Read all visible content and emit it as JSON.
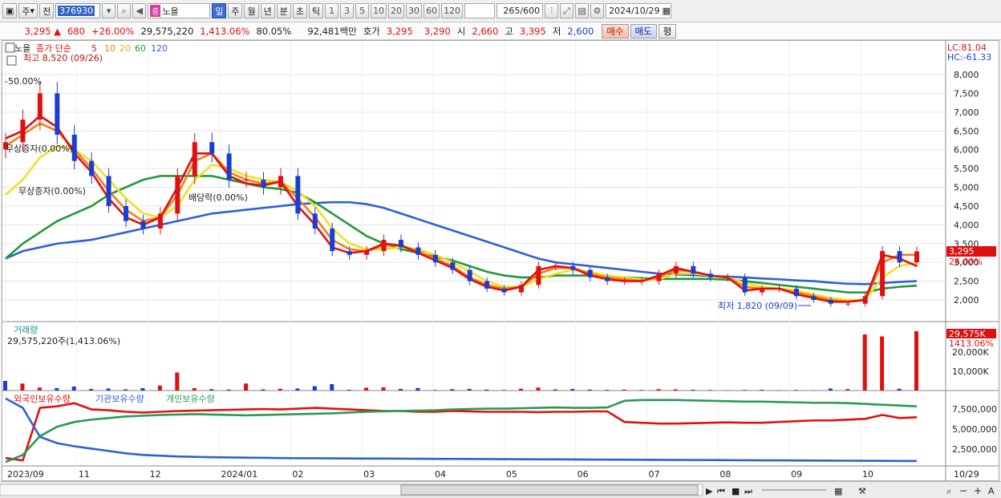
{
  "toolbar": {
    "type_label": "주",
    "prev_label": "전",
    "code": "376930",
    "name_tag": "중",
    "name": "노을",
    "periods": [
      "일",
      "주",
      "월",
      "년",
      "분",
      "초",
      "틱"
    ],
    "active_period": "일",
    "intervals": [
      "1",
      "3",
      "5",
      "10",
      "20",
      "30",
      "60",
      "120"
    ],
    "count": "265",
    "count_max": "/600",
    "date": "2024/10/29"
  },
  "quote": {
    "price": "3,295",
    "change": "680",
    "change_pct": "+26.00%",
    "volume": "29,575,220",
    "volume_ratio": "1,413.06%",
    "turnover": "80.05%",
    "amount": "92,481백만",
    "bid_label": "호가",
    "ask": "3,295",
    "bid": "3,290",
    "open_label": "시",
    "open": "2,660",
    "high_label": "고",
    "high": "3,395",
    "low_label": "저",
    "low": "2,600",
    "buy_label": "매수",
    "sell_label": "매도",
    "eval_label": "평"
  },
  "price_panel": {
    "title": "노을",
    "ma_label": "종가 단순",
    "ma_periods": [
      "5",
      "10",
      "20",
      "60",
      "120"
    ],
    "ma_colors": [
      "#e01010",
      "#f08018",
      "#f0e020",
      "#1f9a3a",
      "#2f5fd8"
    ],
    "high_marker": "최고 8,520 (09/26)",
    "high_pct": "-50.00%",
    "note1": "무상증자(0.00%)",
    "note2": "무상증자(0.00%)",
    "note3": "배당락(0.00%)",
    "low_marker": "최저 1,820 (09/09)",
    "lc": "LC:81.04",
    "hc": "HC:-61.33",
    "y_ticks": [
      "8,000",
      "7,500",
      "7,000",
      "6,500",
      "6,000",
      "5,500",
      "5,000",
      "4,500",
      "4,000",
      "3,500",
      "3,000",
      "2,500",
      "2,000"
    ],
    "last_price_tag": "3,295",
    "last_pct_tag": "26.00%"
  },
  "volume_panel": {
    "title": "거래량",
    "value_label": "29,575,220주(1,413.06%)",
    "y_ticks": [
      "20,000K",
      "10,000K"
    ],
    "last_tag": "29,575K",
    "last_pct": "1413.06%"
  },
  "holdings_panel": {
    "series_labels": [
      "외국인보유수량",
      "기관보유수량",
      "개인보유수량"
    ],
    "series_colors": [
      "#e01010",
      "#2f5fd8",
      "#2a9a55"
    ],
    "y_ticks": [
      "7,500,000",
      "5,000,000",
      "2,500,000"
    ]
  },
  "x_axis": {
    "labels": [
      "2023/09",
      "11",
      "12",
      "2024/01",
      "02",
      "03",
      "04",
      "05",
      "06",
      "07",
      "08",
      "09",
      "10"
    ],
    "right_label": "10/29"
  },
  "chart_data": [
    {
      "type": "candlestick",
      "title": "노을",
      "x_labels": [
        "2023/09",
        "11",
        "12",
        "2024/01",
        "02",
        "03",
        "04",
        "05",
        "06",
        "07",
        "08",
        "09",
        "10"
      ],
      "ylim": [
        1500,
        8500
      ],
      "series": [
        {
          "name": "close",
          "values": [
            6200,
            6800,
            7500,
            6400,
            5700,
            5300,
            4500,
            4100,
            3900,
            4300,
            5300,
            6200,
            5900,
            5200,
            5200,
            5000,
            5300,
            4300,
            3900,
            3300,
            3200,
            3300,
            3600,
            3400,
            3200,
            3000,
            2800,
            2500,
            2300,
            2200,
            2400,
            2900,
            2900,
            2800,
            2600,
            2500,
            2500,
            2500,
            2700,
            2900,
            2700,
            2600,
            2600,
            2200,
            2300,
            2300,
            2100,
            2000,
            1900,
            1900,
            2100,
            3300,
            3000,
            3295
          ]
        },
        {
          "name": "5",
          "values": [
            6300,
            6500,
            6900,
            6600,
            5900,
            5400,
            4700,
            4200,
            4000,
            4200,
            5000,
            5900,
            5900,
            5300,
            5100,
            5050,
            5150,
            4500,
            4000,
            3400,
            3250,
            3300,
            3500,
            3450,
            3250,
            3050,
            2850,
            2550,
            2350,
            2250,
            2350,
            2800,
            2900,
            2850,
            2650,
            2550,
            2500,
            2500,
            2650,
            2850,
            2750,
            2650,
            2600,
            2250,
            2300,
            2300,
            2150,
            2050,
            1950,
            1950,
            2000,
            3200,
            3100,
            2900
          ]
        },
        {
          "name": "10",
          "values": [
            6100,
            6400,
            6700,
            6500,
            6000,
            5500,
            4900,
            4400,
            4100,
            4200,
            4800,
            5700,
            5900,
            5400,
            5200,
            5100,
            5150,
            4700,
            4200,
            3600,
            3350,
            3300,
            3450,
            3450,
            3300,
            3100,
            2900,
            2600,
            2400,
            2300,
            2350,
            2700,
            2850,
            2850,
            2700,
            2600,
            2550,
            2500,
            2600,
            2800,
            2750,
            2650,
            2600,
            2350,
            2300,
            2300,
            2200,
            2100,
            2000,
            1950,
            2000,
            3000,
            3200,
            3200
          ]
        },
        {
          "name": "20",
          "values": [
            4800,
            5200,
            5800,
            6100,
            6000,
            5700,
            5200,
            4700,
            4300,
            4200,
            4500,
            5200,
            5600,
            5500,
            5300,
            5200,
            5150,
            4900,
            4500,
            3900,
            3500,
            3350,
            3350,
            3400,
            3350,
            3200,
            3000,
            2750,
            2500,
            2350,
            2350,
            2550,
            2700,
            2800,
            2750,
            2650,
            2600,
            2550,
            2550,
            2700,
            2700,
            2650,
            2600,
            2450,
            2350,
            2300,
            2250,
            2150,
            2050,
            2000,
            2000,
            2600,
            2900,
            3000
          ]
        },
        {
          "name": "60",
          "values": [
            3100,
            3500,
            3800,
            4100,
            4300,
            4500,
            4800,
            5000,
            5200,
            5300,
            5300,
            5300,
            5300,
            5200,
            5100,
            5000,
            4950,
            4850,
            4600,
            4300,
            4000,
            3700,
            3500,
            3350,
            3250,
            3150,
            3050,
            2900,
            2750,
            2650,
            2600,
            2600,
            2650,
            2650,
            2650,
            2600,
            2600,
            2580,
            2560,
            2560,
            2560,
            2560,
            2540,
            2500,
            2450,
            2400,
            2350,
            2300,
            2250,
            2200,
            2200,
            2300,
            2350,
            2380
          ]
        },
        {
          "name": "120",
          "values": [
            3100,
            3300,
            3400,
            3500,
            3550,
            3600,
            3700,
            3800,
            3900,
            4000,
            4100,
            4200,
            4300,
            4350,
            4400,
            4450,
            4500,
            4550,
            4580,
            4600,
            4600,
            4550,
            4450,
            4300,
            4150,
            4000,
            3850,
            3700,
            3550,
            3400,
            3250,
            3100,
            3000,
            2950,
            2900,
            2850,
            2800,
            2750,
            2700,
            2680,
            2660,
            2640,
            2620,
            2600,
            2570,
            2550,
            2520,
            2500,
            2460,
            2430,
            2420,
            2450,
            2480,
            2500
          ]
        }
      ],
      "high": 8520,
      "low": 1820,
      "legend": "top-left"
    },
    {
      "type": "bar",
      "title": "거래량",
      "ylim": [
        0,
        30000
      ],
      "unit": "K",
      "values": [
        4800,
        3500,
        1500,
        1200,
        2000,
        800,
        1000,
        600,
        1200,
        2500,
        9000,
        1200,
        700,
        500,
        3500,
        600,
        900,
        1000,
        2200,
        3200,
        400,
        1400,
        1600,
        800,
        1300,
        300,
        700,
        800,
        500,
        300,
        900,
        1500,
        600,
        800,
        500,
        400,
        500,
        300,
        700,
        600,
        400,
        300,
        200,
        300,
        400,
        200,
        300,
        200,
        1000,
        700,
        28000,
        27000,
        900,
        29575
      ]
    },
    {
      "type": "line",
      "ylim": [
        0,
        9000000
      ],
      "series": [
        {
          "name": "외국인보유수량",
          "values": [
            800000,
            500000,
            7200000,
            7400000,
            7800000,
            7000000,
            6900000,
            6700000,
            6600000,
            6700000,
            6800000,
            6850000,
            6900000,
            6950000,
            7000000,
            7050000,
            7000000,
            7100000,
            7200000,
            7100000,
            7000000,
            6900000,
            6800000,
            6800000,
            6700000,
            6700000,
            6800000,
            6750000,
            6700000,
            6700000,
            6700000,
            6650000,
            6700000,
            6700000,
            6750000,
            6750000,
            5400000,
            5300000,
            5200000,
            5200000,
            5250000,
            5300000,
            5350000,
            5300000,
            5300000,
            5400000,
            5500000,
            5600000,
            5600000,
            5700000,
            5800000,
            6300000,
            5900000,
            6000000
          ]
        },
        {
          "name": "기관보유수량",
          "values": [
            8400000,
            7200000,
            3500000,
            2700000,
            2300000,
            2000000,
            1700000,
            1400000,
            1200000,
            1100000,
            1000000,
            950000,
            900000,
            880000,
            850000,
            830000,
            800000,
            780000,
            770000,
            760000,
            750000,
            740000,
            730000,
            720000,
            710000,
            700000,
            690000,
            680000,
            670000,
            660000,
            650000,
            640000,
            630000,
            620000,
            610000,
            600000,
            590000,
            580000,
            570000,
            560000,
            550000,
            540000,
            530000,
            520000,
            510000,
            500000,
            490000,
            480000,
            470000,
            460000,
            450000,
            440000,
            430000,
            430000
          ]
        },
        {
          "name": "개인보유수량",
          "values": [
            300000,
            1200000,
            3600000,
            4800000,
            5400000,
            5700000,
            5900000,
            6100000,
            6200000,
            6300000,
            6350000,
            6400000,
            6350000,
            6300000,
            6250000,
            6300000,
            6350000,
            6400000,
            6450000,
            6500000,
            6600000,
            6700000,
            6750000,
            6800000,
            6850000,
            6900000,
            7000000,
            7050000,
            7100000,
            7100000,
            7150000,
            7200000,
            7250000,
            7200000,
            7200000,
            7250000,
            8100000,
            8200000,
            8200000,
            8200000,
            8150000,
            8100000,
            8050000,
            8000000,
            8000000,
            7950000,
            7900000,
            7850000,
            7850000,
            7800000,
            7700000,
            7600000,
            7500000,
            7400000
          ]
        }
      ]
    }
  ]
}
